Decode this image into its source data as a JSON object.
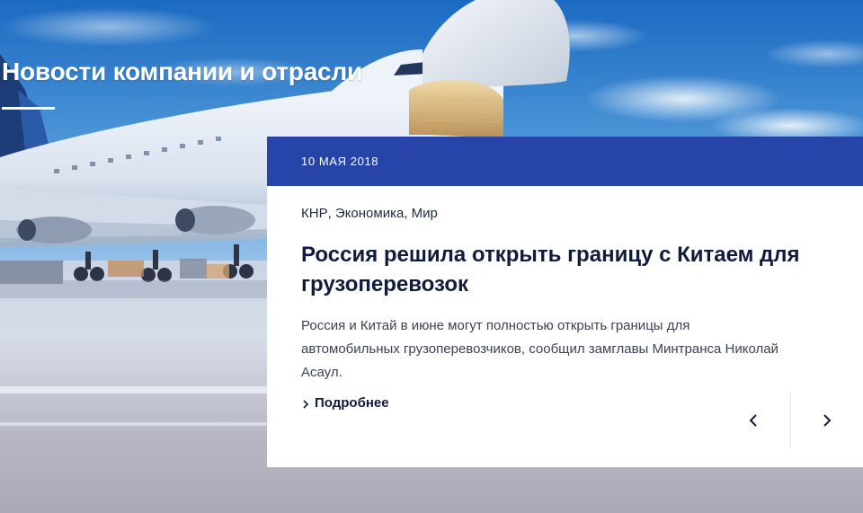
{
  "section": {
    "title": "Новости компании и отрасли"
  },
  "news_card": {
    "date": "10 МАЯ 2018",
    "tags": [
      "КНР",
      "Экономика",
      "Мир"
    ],
    "tag_separator": ", ",
    "headline": "Россия решила открыть границу с Китаем для грузоперевозок",
    "excerpt": "Россия и Китай в июне могут полностью открыть границы для автомобильных грузоперевозчиков, сообщил замглавы Минтранса Николай Асаул.",
    "more_label": "Подробнее",
    "more_icon": "chevron-right-icon"
  },
  "slider_nav": {
    "prev_icon": "chevron-left-icon",
    "next_icon": "chevron-right-icon"
  },
  "colors": {
    "date_bar": "#2745a8",
    "headline": "#0f1c3d",
    "body_text": "#3a4255",
    "sky_top": "#1c6fc4",
    "sky_bottom": "#9cc3e6"
  }
}
